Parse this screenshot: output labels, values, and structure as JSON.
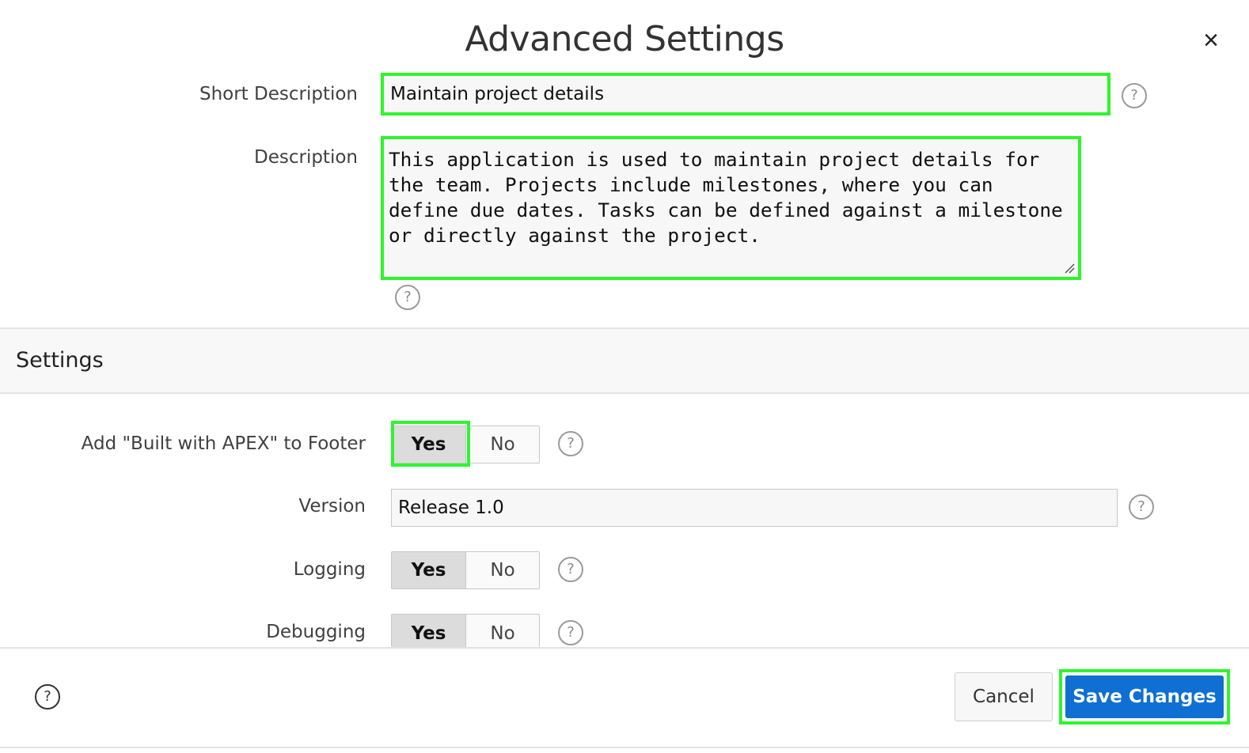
{
  "dialog": {
    "title": "Advanced Settings",
    "close_symbol": "×",
    "close_icon": "close-icon"
  },
  "fields": {
    "short_description": {
      "label": "Short Description",
      "value": "Maintain project details"
    },
    "description": {
      "label": "Description",
      "value": "This application is used to maintain project details for the team. Projects include milestones, where you can define due dates. Tasks can be defined against a milestone or directly against the project."
    }
  },
  "settings": {
    "section_title": "Settings",
    "built_with_apex": {
      "label": "Add \"Built with APEX\" to Footer",
      "yes": "Yes",
      "no": "No",
      "selected": "Yes"
    },
    "version": {
      "label": "Version",
      "value": "Release 1.0"
    },
    "logging": {
      "label": "Logging",
      "yes": "Yes",
      "no": "No",
      "selected": "Yes"
    },
    "debugging": {
      "label": "Debugging",
      "yes": "Yes",
      "no": "No",
      "selected": "Yes"
    }
  },
  "help_symbol": "?",
  "footer": {
    "cancel_label": "Cancel",
    "save_label": "Save Changes"
  },
  "colors": {
    "highlight": "#2ef52e",
    "primary_button": "#0f6fd2"
  }
}
